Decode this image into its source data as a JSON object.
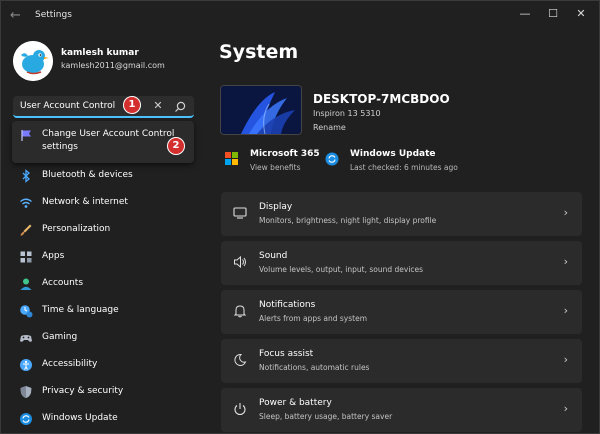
{
  "window": {
    "title": "Settings",
    "back_glyph": "←",
    "minimize_glyph": "—",
    "maximize_glyph": "☐",
    "close_glyph": "✕"
  },
  "profile": {
    "name": "kamlesh kumar",
    "email": "kamlesh2011@gmail.com",
    "avatar_icon": "twitter-bird-avatar"
  },
  "search": {
    "value": "User Account Control",
    "clear_glyph": "✕",
    "accent": "#4cc2ff"
  },
  "annotations": {
    "badge_1": "1",
    "badge_2": "2",
    "badge_color": "#d32f2f"
  },
  "suggestion": {
    "label": "Change User Account Control settings",
    "icon": "flag-icon"
  },
  "sidebar": {
    "items": [
      {
        "label": "Bluetooth & devices",
        "icon": "bluetooth-icon"
      },
      {
        "label": "Network & internet",
        "icon": "wifi-icon"
      },
      {
        "label": "Personalization",
        "icon": "brush-icon"
      },
      {
        "label": "Apps",
        "icon": "apps-icon"
      },
      {
        "label": "Accounts",
        "icon": "accounts-icon"
      },
      {
        "label": "Time & language",
        "icon": "time-language-icon"
      },
      {
        "label": "Gaming",
        "icon": "gaming-icon"
      },
      {
        "label": "Accessibility",
        "icon": "accessibility-icon"
      },
      {
        "label": "Privacy & security",
        "icon": "shield-icon"
      },
      {
        "label": "Windows Update",
        "icon": "windows-update-icon"
      }
    ]
  },
  "main": {
    "title": "System",
    "device": {
      "name": "DESKTOP-7MCBDOO",
      "model": "Inspiron 13 5310",
      "rename": "Rename"
    },
    "quick": [
      {
        "title": "Microsoft 365",
        "subtitle": "View benefits",
        "icon": "microsoft-365-icon"
      },
      {
        "title": "Windows Update",
        "subtitle": "Last checked: 6 minutes ago",
        "icon": "windows-update-icon"
      }
    ],
    "cards": [
      {
        "title": "Display",
        "subtitle": "Monitors, brightness, night light, display profile",
        "icon": "display-icon"
      },
      {
        "title": "Sound",
        "subtitle": "Volume levels, output, input, sound devices",
        "icon": "sound-icon"
      },
      {
        "title": "Notifications",
        "subtitle": "Alerts from apps and system",
        "icon": "bell-icon"
      },
      {
        "title": "Focus assist",
        "subtitle": "Notifications, automatic rules",
        "icon": "moon-icon"
      },
      {
        "title": "Power & battery",
        "subtitle": "Sleep, battery usage, battery saver",
        "icon": "power-icon"
      }
    ],
    "chevron_glyph": "›"
  }
}
